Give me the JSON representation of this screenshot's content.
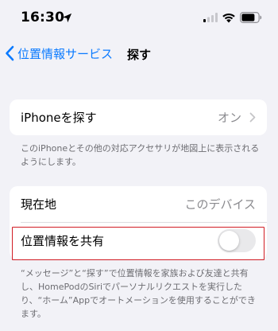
{
  "status_bar": {
    "time": "16:30",
    "location_icon": "location-arrow-icon",
    "signal_icon": "cellular-signal-icon",
    "wifi_icon": "wifi-icon",
    "battery_icon": "battery-icon"
  },
  "nav": {
    "back_label": "位置情報サービス",
    "title": "探す"
  },
  "find_iphone": {
    "label": "iPhoneを探す",
    "value": "オン",
    "footnote": "このiPhoneとその他の対応アクセサリが地図上に表示されるようにします。"
  },
  "location_group": {
    "current_location_label": "現在地",
    "current_location_value": "このデバイス",
    "share_location_label": "位置情報を共有",
    "share_location_enabled": false,
    "footnote": "“メッセージ”と“探す”で位置情報を家族および友達と共有し、HomePodのSiriでパーソナルリクエストを実行したり、“ホーム”Appでオートメーションを使用することができます。"
  },
  "colors": {
    "accent": "#0a7aff",
    "highlight": "#d11c24",
    "background": "#f2f2f7"
  }
}
